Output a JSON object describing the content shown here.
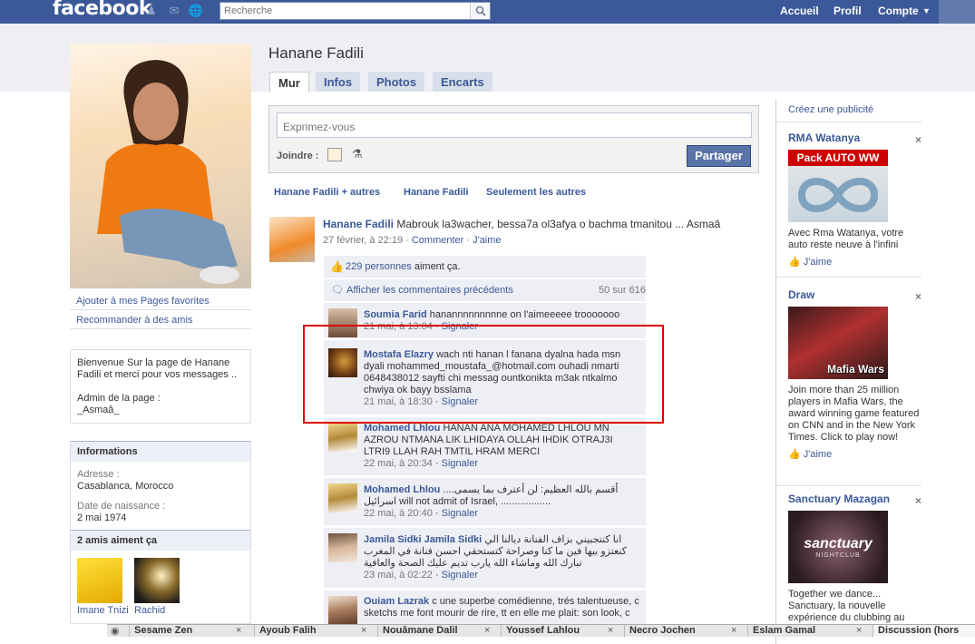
{
  "topbar": {
    "logo": "facebook",
    "search_placeholder": "Recherche",
    "nav": [
      "Accueil",
      "Profil",
      "Compte"
    ]
  },
  "profile": {
    "name": "Hanane Fadili",
    "tabs": [
      "Mur",
      "Infos",
      "Photos",
      "Encarts"
    ],
    "links": [
      "Ajouter à mes Pages favorites",
      "Recommander à des amis"
    ],
    "bio": "Bienvenue Sur la page de Hanane Fadili et merci pour vos messages ..",
    "admin_label": "Admin de la page :",
    "admin_name": "_Asmaâ_"
  },
  "info": {
    "heading": "Informations",
    "address_label": "Adresse :",
    "address": "Casablanca, Morocco",
    "birth_label": "Date de naissance :",
    "birth": "2 mai 1974",
    "friends_heading": "2 amis aiment ça",
    "friends": [
      "Imane Tnizi",
      "Rachid"
    ]
  },
  "composer": {
    "placeholder": "Exprimez-vous",
    "attach_label": "Joindre :",
    "share_label": "Partager"
  },
  "filters": [
    "Hanane Fadili + autres",
    "Hanane Fadili",
    "Seulement les autres"
  ],
  "post": {
    "author": "Hanane Fadili",
    "text": "Mabrouk la3wacher, bessa7a ol3afya o bachma tmanitou ... Asmaâ",
    "date": "27 février, à 22:19",
    "comment_link": "Commenter",
    "like_link": "J'aime"
  },
  "likes": {
    "count": "229 personnes",
    "suffix": "aiment ça."
  },
  "prev_comments": {
    "label": "Afficher les commentaires précédents",
    "count": "50 sur 616"
  },
  "comments": [
    {
      "name": "Soumia Farid",
      "text": "hanannnnnnnnne on l'aimeeeee trooooooo",
      "date": "21 mai, à 13:04",
      "action": "Signaler"
    },
    {
      "name": "Mostafa Elazry",
      "text": "wach nti hanan l fanana dyalna hada msn dyali mohammed_moustafa_@hotmail.com ouhadi nmarti 0648438012 sayfti chi messag ountkonikta m3ak ntkalmo chwiya ok bayy bsslama",
      "date": "21 mai, à 18:30",
      "action": "Signaler"
    },
    {
      "name": "Mohamed Lhlou",
      "text": "HANAN ANA MOHAMED LHLOU MN AZROU NTMANA LIK LHIDAYA OLLAH IHDIK OTRAJ3I LTRI9 LLAH RAH TMTIL HRAM MERCI",
      "date": "22 mai, à 20:34",
      "action": "Signaler"
    },
    {
      "name": "Mohamed Lhlou",
      "text": "أقسم بالله العظيم: لن أعترف بما يسمى.... اسرائيل will not admit of Israel, ..................",
      "date": "22 mai, à 20:40",
      "action": "Signaler"
    },
    {
      "name": "Jamila Sidki Jamila Sidki",
      "text": "انا كنتجبيني بزاف الفنانة ديالنا الي كنعتزو بيها فين ما كنا وصراحة كتستحقي احسن فنانة في المغرب تبارك الله وماشاء الله يارب تديم عليك الصحة والعافية",
      "date": "23 mai, à 02:22",
      "action": "Signaler"
    },
    {
      "name": "Ouiam Lazrak",
      "text": "c une superbe comédienne, trés talentueuse, c sketchs me font mourir de rire, tt en elle me plait: son look, c",
      "date": "",
      "action": ""
    }
  ],
  "ads": {
    "create": "Créez une publicité",
    "items": [
      {
        "title": "RMA Watanya",
        "image_label": "Pack AUTO WW",
        "text": "Avec Rma Watanya, votre auto reste neuve à l'infini",
        "like": "J'aime"
      },
      {
        "title": "Draw",
        "image_label": "Mafia Wars",
        "text": "Join more than 25 million players in Mafia Wars, the award winning game featured on CNN and in the New York Times. Click to play now!",
        "like": "J'aime"
      },
      {
        "title": "Sanctuary Mazagan",
        "image_label": "sanctuary",
        "image_sub": "NIGHTCLUB",
        "text": "Together we dance... Sanctuary, la nouvelle expérience du clubbing au",
        "like": ""
      }
    ]
  },
  "chat": [
    "Sesame Zen",
    "Ayoub Falih",
    "Nouâmane Dalil",
    "Youssef Lahlou",
    "Necro Jochen",
    "Eslam Gamal",
    "Discussion (hors"
  ]
}
